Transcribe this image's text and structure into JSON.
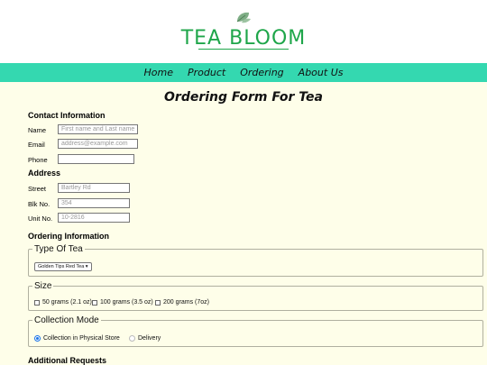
{
  "brand": {
    "name": "TEA BLOOM",
    "logo_icon": "leaf-icon",
    "color": "#1fa64a"
  },
  "nav": {
    "items": [
      "Home",
      "Product",
      "Ordering",
      "About Us"
    ],
    "bg_color": "#34d8b0"
  },
  "page": {
    "title": "Ordering Form For Tea",
    "bg_color": "#fefee9"
  },
  "contact": {
    "heading": "Contact Information",
    "name_label": "Name",
    "name_placeholder": "First name and Last name",
    "email_label": "Email",
    "email_placeholder": "address@example.com",
    "phone_label": "Phone",
    "phone_value": ""
  },
  "address": {
    "heading": "Address",
    "street_label": "Street",
    "street_placeholder": "Bartley Rd",
    "blk_label": "Blk No.",
    "blk_placeholder": "354",
    "unit_label": "Unit No.",
    "unit_placeholder": "10-2816"
  },
  "ordering": {
    "heading": "Ordering Information",
    "type_legend": "Type Of Tea",
    "type_selected": "Golden Tips Red Tea",
    "size_legend": "Size",
    "sizes": [
      "50 grams (2.1 oz)",
      "100 grams (3.5 oz)",
      "200 grams (7oz)"
    ],
    "collection_legend": "Collection Mode",
    "collection_options": [
      "Collection in Physical Store",
      "Delivery"
    ],
    "collection_selected": "Collection in Physical Store"
  },
  "additional": {
    "heading": "Additional Requests"
  }
}
